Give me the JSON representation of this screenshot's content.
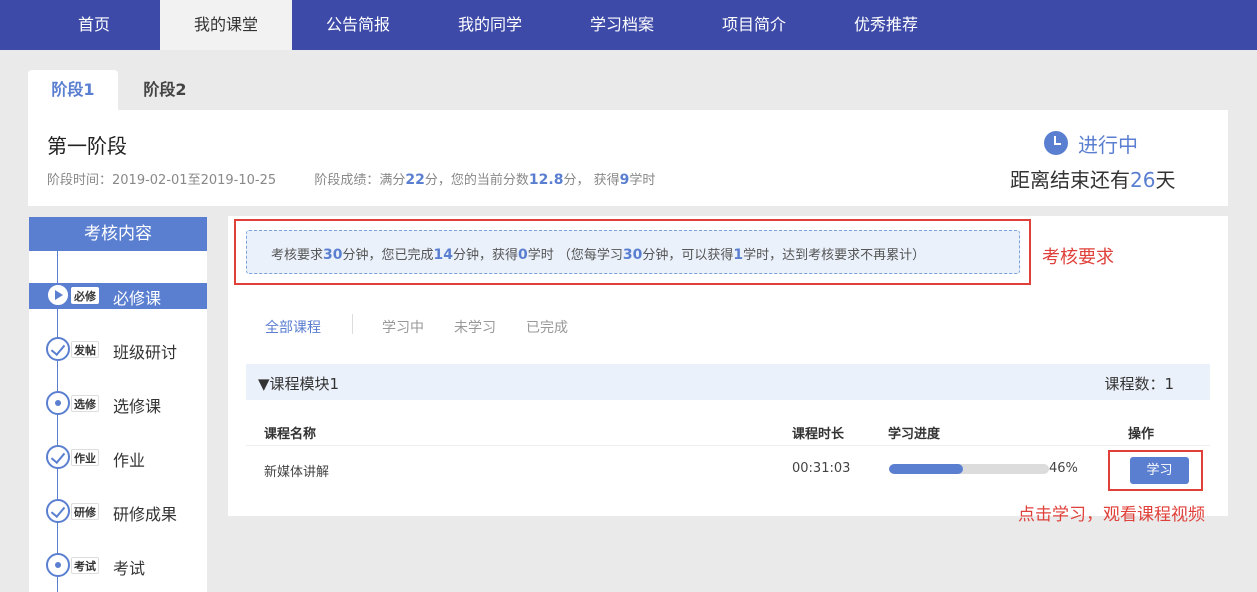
{
  "nav": {
    "items": [
      {
        "label": "首页"
      },
      {
        "label": "我的课堂"
      },
      {
        "label": "公告简报"
      },
      {
        "label": "我的同学"
      },
      {
        "label": "学习档案"
      },
      {
        "label": "项目简介"
      },
      {
        "label": "优秀推荐"
      }
    ],
    "active_index": 1,
    "bar_color": "#3e4aa8"
  },
  "stage_tabs": [
    {
      "label": "阶段1",
      "active": true
    },
    {
      "label": "阶段2",
      "active": false
    }
  ],
  "stage": {
    "title": "第一阶段",
    "time_label": "阶段时间：",
    "time_value": "2019-02-01至2019-10-25",
    "score_prefix": "阶段成绩：满分",
    "full_score": "22",
    "score_mid": "分，您的当前分数",
    "current_score": "12.8",
    "score_mid2": "分，  获得",
    "hours": "9",
    "score_suffix": "学时",
    "status": "进行中",
    "countdown_prefix": "距离结束还有",
    "countdown_days": "26",
    "countdown_suffix": "天",
    "status_icon": "clock-icon"
  },
  "sidebar": {
    "title": "考核内容",
    "items": [
      {
        "tag": "必修",
        "label": "必修课",
        "icon": "play-icon",
        "active": true
      },
      {
        "tag": "发帖",
        "label": "班级研讨",
        "icon": "check-icon",
        "active": false
      },
      {
        "tag": "选修",
        "label": "选修课",
        "icon": "dot-icon",
        "active": false
      },
      {
        "tag": "作业",
        "label": "作业",
        "icon": "check-icon",
        "active": false
      },
      {
        "tag": "研修",
        "label": "研修成果",
        "icon": "check-icon",
        "active": false
      },
      {
        "tag": "考试",
        "label": "考试",
        "icon": "dot-icon",
        "active": false
      }
    ]
  },
  "requirement": {
    "p1": "考核要求",
    "required_minutes": "30",
    "p2": "分钟，您已完成",
    "done_minutes": "14",
    "p3": "分钟，获得",
    "earned_hours": "0",
    "p4": "学时  （您每学习",
    "per_minutes": "30",
    "p5": "分钟，可以获得",
    "per_hours": "1",
    "p6": "学时，达到考核要求不再累计）"
  },
  "annotations": {
    "requirement_note": "考核要求",
    "study_note": "点击学习，观看课程视频",
    "color": "#e0403a"
  },
  "filters": [
    {
      "label": "全部课程",
      "active": true
    },
    {
      "label": "学习中",
      "active": false
    },
    {
      "label": "未学习",
      "active": false
    },
    {
      "label": "已完成",
      "active": false
    }
  ],
  "module": {
    "name": "▼课程模块1",
    "count_label": "课程数：1"
  },
  "table": {
    "headers": {
      "name": "课程名称",
      "duration": "课程时长",
      "progress": "学习进度",
      "action": "操作"
    },
    "rows": [
      {
        "name": "新媒体讲解",
        "duration": "00:31:03",
        "progress": 0.46,
        "progress_text": "46%",
        "action": "学习"
      }
    ]
  },
  "accent_color": "#5b7fd0"
}
